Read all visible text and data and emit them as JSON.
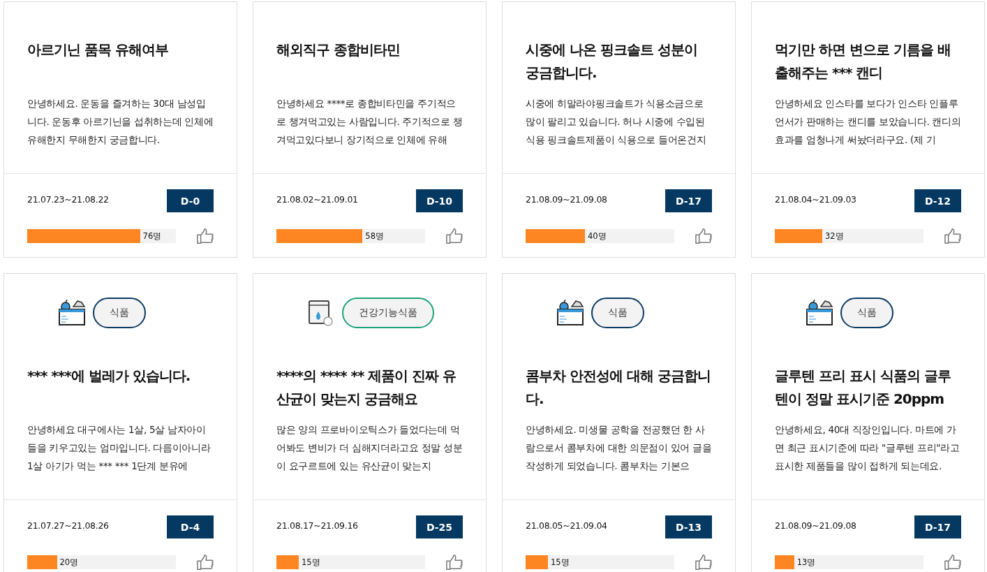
{
  "cards": [
    {
      "title": "아르기닌 품목 유해여부",
      "text": "안녕하세요. 운동을 즐겨하는 30대 남성입니다. 운동후 아르기닌을 섭취하는데 인체에 유해한지 무해한지 궁금합니다.",
      "period": "21.07.23~21.08.22",
      "dday": "D-0",
      "count": "76명",
      "level": 0.76
    },
    {
      "title": "해외직구 종합비타민",
      "text": "안녕하세요 ****로 종합비타민을 주기적으로 챙겨먹고있는 사람입니다. 주기적으로 챙겨먹고있다보니 장기적으로 인체에 유해",
      "period": "21.08.02~21.09.01",
      "dday": "D-10",
      "count": "58명",
      "level": 0.58
    },
    {
      "title": "시중에 나온 핑크솔트 성분이 궁금합니다.",
      "text": "시중에 히말라야핑크솔트가 식용소금으로 많이 팔리고 있습니다. 허나 시중에 수입된 식용 핑크솔트제품이 식용으로 들어온건지",
      "period": "21.08.09~21.09.08",
      "dday": "D-17",
      "count": "40명",
      "level": 0.4
    },
    {
      "title": "먹기만 하면 변으로 기름을 배출해주는 *** 캔디",
      "text": "안녕하세요 인스타를 보다가 인스타 인플루언서가 판매하는 캔디를 보았습니다. 캔디의 효과를 엄청나게 써놨더라구요. (제 기",
      "period": "21.08.04~21.09.03",
      "dday": "D-12",
      "count": "32명",
      "level": 0.32
    },
    {
      "category": {
        "kind": "food",
        "label": "식품"
      },
      "title": "*** ***에 벌레가 있습니다.",
      "text": "안녕하세요 대구에사는 1살, 5살 남자아이들을 키우고있는 엄마입니다. 다름이아니라 1살 아기가 먹는 *** *** 1단계 분유에",
      "period": "21.07.27~21.08.26",
      "dday": "D-4",
      "count": "20명",
      "level": 0.2
    },
    {
      "category": {
        "kind": "health",
        "label": "건강기능식품"
      },
      "title": "****의 **** ** 제품이 진짜 유산균이 맞는지 궁금해요",
      "text": "많은 양의 프로바이오틱스가 들었다는데 먹어봐도 변비가 더 심해지더라고요 정말 성분이 요구르트에 있는 유산균이 맞는지",
      "period": "21.08.17~21.09.16",
      "dday": "D-25",
      "count": "15명",
      "level": 0.15
    },
    {
      "category": {
        "kind": "food",
        "label": "식품"
      },
      "title": "콤부차 안전성에 대해 궁금합니다.",
      "text": "안녕하세요. 미생물 공학을 전공했던 한 사람으로서 콤부차에 대한 의문점이 있어 글을 작성하게 되었습니다. 콤부차는 기본으",
      "period": "21.08.05~21.09.04",
      "dday": "D-13",
      "count": "15명",
      "level": 0.15
    },
    {
      "category": {
        "kind": "food",
        "label": "식품"
      },
      "title": "글루텐 프리 표시 식품의 글루텐이 정말 표시기준 20ppm",
      "text": "안녕하세요, 40대 직장인입니다. 마트에 가면 최근 표시기준에 따라 \"글루텐 프리\"라고 표시한 제품들을 많이 접하게 되는데요.",
      "period": "21.08.09~21.09.08",
      "dday": "D-17",
      "count": "13명",
      "level": 0.13
    }
  ]
}
